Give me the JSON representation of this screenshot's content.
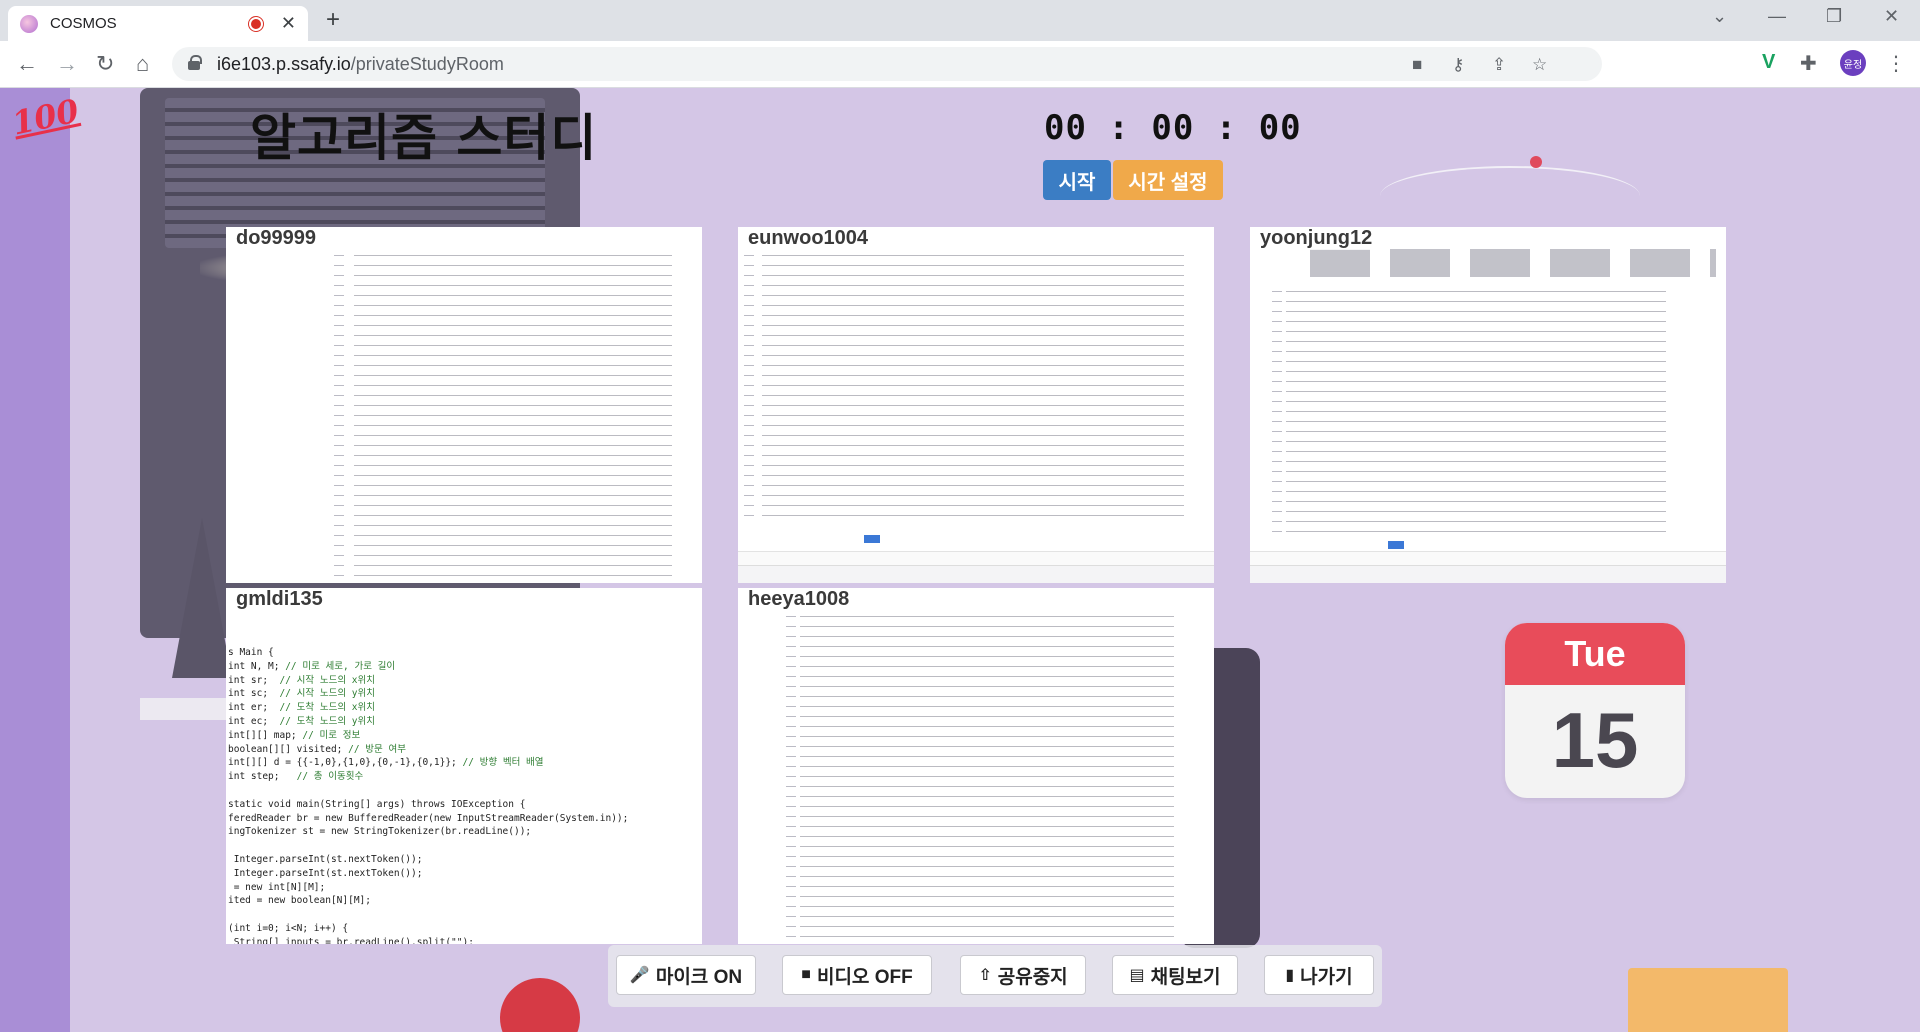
{
  "browser": {
    "tab_title": "COSMOS",
    "new_tab": "+",
    "url_host": "i6e103.p.ssafy.io",
    "url_path": "/privateStudyRoom",
    "profile_initials": "윤정"
  },
  "room": {
    "title": "알고리즘 스터디",
    "timer": "00 : 00 : 00",
    "start_button": "시작",
    "set_time_button": "시간 설정"
  },
  "calendar": {
    "weekday": "Tue",
    "day": "15"
  },
  "participants": [
    {
      "username": "do99999"
    },
    {
      "username": "eunwoo1004"
    },
    {
      "username": "yoonjung12"
    },
    {
      "username": "gmldi135"
    },
    {
      "username": "heeya1008"
    }
  ],
  "shared_code": {
    "lines": [
      "s Main {",
      "int N, M; // 미로 세로, 가로 길이",
      "int sr;  // 시작 노드의 x위치",
      "int sc;  // 시작 노드의 y위치",
      "int er;  // 도착 노드의 x위치",
      "int ec;  // 도착 노드의 y위치",
      "int[][] map; // 미로 정보",
      "boolean[][] visited; // 방문 여부",
      "int[][] d = {{-1,0},{1,0},{0,-1},{0,1}}; // 방향 벡터 배열",
      "int step;   // 총 이동횟수",
      "",
      "static void main(String[] args) throws IOException {",
      "feredReader br = new BufferedReader(new InputStreamReader(System.in));",
      "ingTokenizer st = new StringTokenizer(br.readLine());",
      "",
      " Integer.parseInt(st.nextToken());",
      " Integer.parseInt(st.nextToken());",
      " = new int[N][M];",
      "ited = new boolean[N][M];",
      "",
      "(int i=0; i<N; i++) {",
      " String[] inputs = br.readLine().split(\"\");"
    ]
  },
  "controls": {
    "mic": "마이크 ON",
    "video": "비디오 OFF",
    "share": "공유중지",
    "chat": "채팅보기",
    "leave": "나가기"
  }
}
